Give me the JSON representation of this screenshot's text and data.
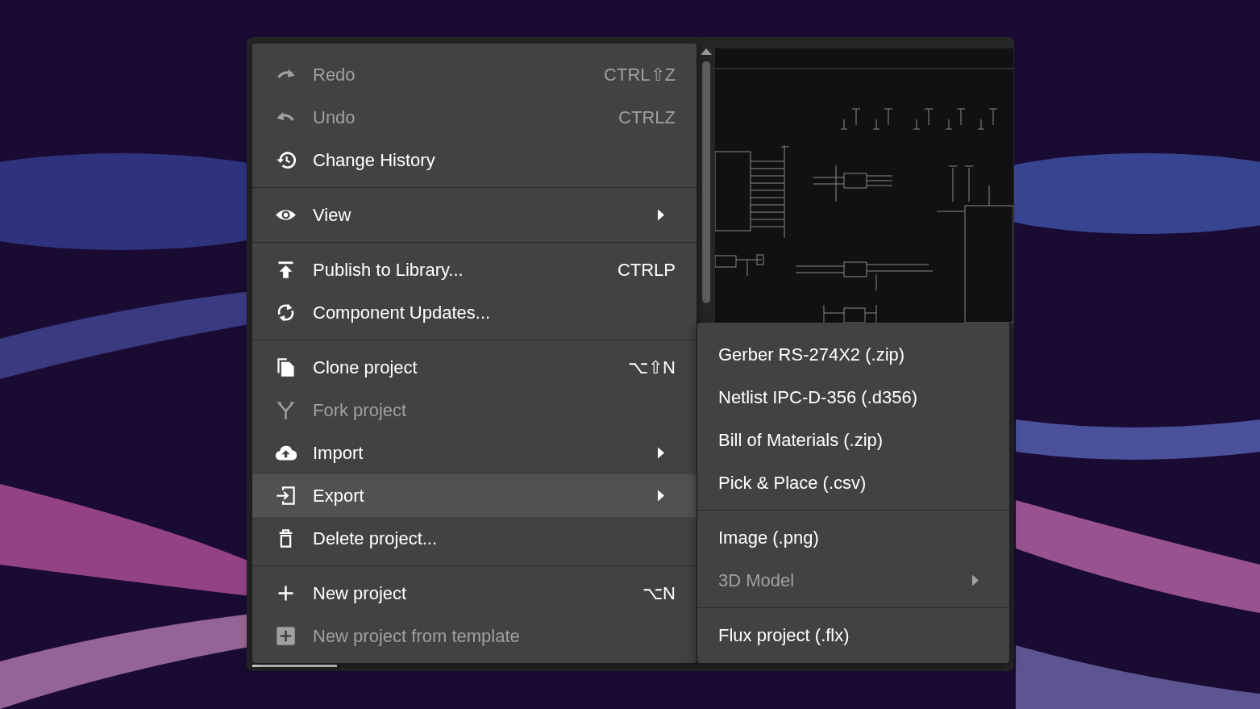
{
  "menu": {
    "groups": [
      {
        "items": [
          {
            "label": "Redo",
            "shortcut": "CTRL⇧Z",
            "disabled": true,
            "has_submenu": false,
            "selected": false
          },
          {
            "label": "Undo",
            "shortcut": "CTRLZ",
            "disabled": true,
            "has_submenu": false,
            "selected": false
          },
          {
            "label": "Change History",
            "disabled": false,
            "has_submenu": false,
            "selected": false
          }
        ]
      },
      {
        "items": [
          {
            "label": "View",
            "disabled": false,
            "has_submenu": true,
            "selected": false
          }
        ]
      },
      {
        "items": [
          {
            "label": "Publish to Library...",
            "shortcut": "CTRLP",
            "disabled": false,
            "has_submenu": false,
            "selected": false
          },
          {
            "label": "Component Updates...",
            "disabled": false,
            "has_submenu": false,
            "selected": false
          }
        ]
      },
      {
        "items": [
          {
            "label": "Clone project",
            "shortcut": "⌥⇧N",
            "disabled": false,
            "has_submenu": false,
            "selected": false
          },
          {
            "label": "Fork project",
            "disabled": true,
            "has_submenu": false,
            "selected": false
          },
          {
            "label": "Import",
            "disabled": false,
            "has_submenu": true,
            "selected": false
          },
          {
            "label": "Export",
            "disabled": false,
            "has_submenu": true,
            "selected": true
          },
          {
            "label": "Delete project...",
            "disabled": false,
            "has_submenu": false,
            "selected": false
          }
        ]
      },
      {
        "items": [
          {
            "label": "New project",
            "shortcut": "⌥N",
            "disabled": false,
            "has_submenu": false,
            "selected": false
          },
          {
            "label": "New project from template",
            "disabled": true,
            "has_submenu": false,
            "selected": false
          }
        ]
      }
    ]
  },
  "submenu": {
    "groups": [
      {
        "items": [
          {
            "label": "Gerber RS-274X2 (.zip)",
            "disabled": false,
            "has_submenu": false
          },
          {
            "label": "Netlist IPC-D-356 (.d356)",
            "disabled": false,
            "has_submenu": false
          },
          {
            "label": "Bill of Materials (.zip)",
            "disabled": false,
            "has_submenu": false
          },
          {
            "label": "Pick & Place (.csv)",
            "disabled": false,
            "has_submenu": false
          }
        ]
      },
      {
        "items": [
          {
            "label": "Image (.png)",
            "disabled": false,
            "has_submenu": false
          },
          {
            "label": "3D Model",
            "disabled": true,
            "has_submenu": true
          }
        ]
      },
      {
        "items": [
          {
            "label": "Flux project (.flx)",
            "disabled": false,
            "has_submenu": false
          }
        ]
      }
    ]
  }
}
